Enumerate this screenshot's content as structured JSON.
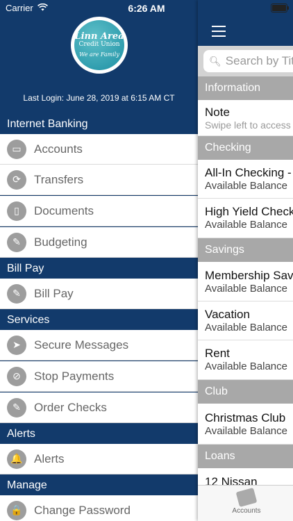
{
  "status": {
    "carrier": "Carrier",
    "time": "6:26 AM"
  },
  "logo": {
    "line1": "Linn Area",
    "line2": "Credit Union",
    "line3": "We are Family"
  },
  "last_login": "Last Login: June 28, 2019 at 6:15 AM CT",
  "menu": {
    "internet_banking": "Internet Banking",
    "accounts": "Accounts",
    "transfers": "Transfers",
    "documents": "Documents",
    "budgeting": "Budgeting",
    "bill_pay_section": "Bill Pay",
    "bill_pay": "Bill Pay",
    "services": "Services",
    "secure_messages": "Secure Messages",
    "stop_payments": "Stop Payments",
    "order_checks": "Order Checks",
    "alerts_section": "Alerts",
    "alerts": "Alerts",
    "manage": "Manage",
    "change_password": "Change Password"
  },
  "panel": {
    "search_placeholder": "Search by Tit",
    "information": "Information",
    "note_title": "Note",
    "note_sub": "Swipe left to access",
    "checking": "Checking",
    "acct1_title": "All-In Checking -",
    "acct1_sub": "Available Balance",
    "acct2_title": "High Yield Check",
    "acct2_sub": "Available Balance",
    "savings": "Savings",
    "acct3_title": "Membership Sav",
    "acct3_sub": "Available Balance",
    "acct4_title": "Vacation",
    "acct4_sub": "Available Balance",
    "acct5_title": "Rent",
    "acct5_sub": "Available Balance",
    "club": "Club",
    "acct6_title": "Christmas Club",
    "acct6_sub": "Available Balance",
    "loans": "Loans",
    "acct7_title": "12 Nissan",
    "tab_accounts": "Accounts"
  }
}
